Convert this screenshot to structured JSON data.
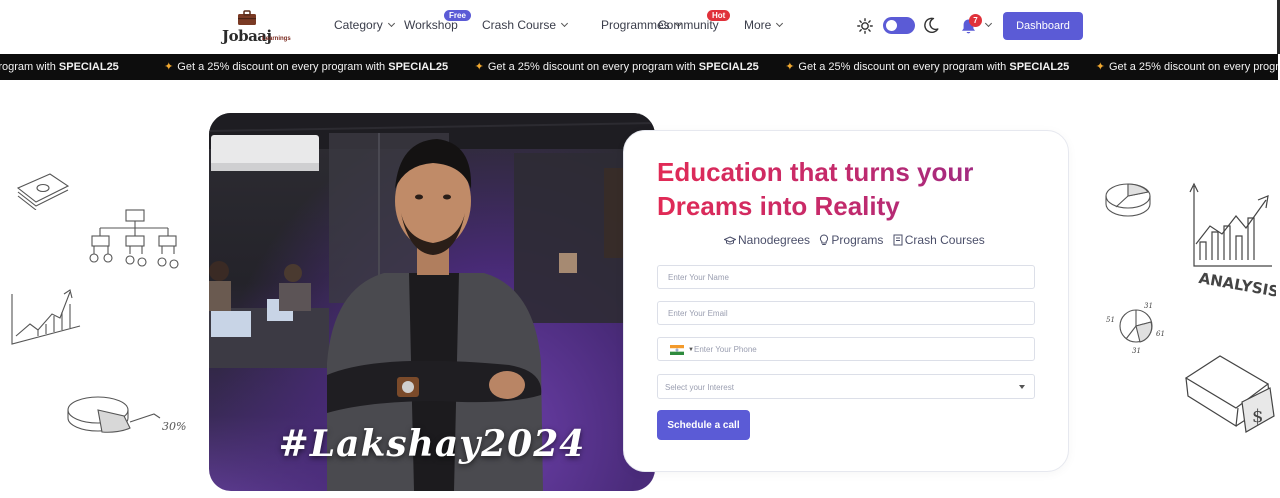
{
  "brand": {
    "logo_text": "Jobaaj",
    "logo_subtext": "Learnings"
  },
  "nav": {
    "items": [
      {
        "label": "Category",
        "has_dropdown": true
      },
      {
        "label": "Workshop",
        "has_dropdown": false,
        "badge": "Free"
      },
      {
        "label": "Crash Course",
        "has_dropdown": true
      },
      {
        "label": "Programmes",
        "has_dropdown": true
      },
      {
        "label": "Community",
        "has_dropdown": false,
        "badge": "Hot"
      },
      {
        "label": "More",
        "has_dropdown": true
      }
    ],
    "theme_toggle": {
      "mode": "light",
      "icons": [
        "sun-icon",
        "moon-icon"
      ]
    },
    "notifications": {
      "count": "7"
    },
    "dashboard_label": "Dashboard"
  },
  "ticker": {
    "prefix": "Get a 25% discount on every program with",
    "code": "SPECIAL25",
    "leading_fragment": "on every program with",
    "icon": "party-popper-icon"
  },
  "hero": {
    "hashtag": "#Lakshay2024"
  },
  "form": {
    "headline_line1": "Education that turns your",
    "headline_line2": "Dreams into Reality",
    "tags": [
      {
        "label": "Nanodegrees",
        "icon": "graduation-cap-icon"
      },
      {
        "label": "Programs",
        "icon": "lightbulb-icon"
      },
      {
        "label": "Crash Courses",
        "icon": "book-icon"
      }
    ],
    "name_placeholder": "Enter Your Name",
    "email_placeholder": "Enter Your Email",
    "phone_placeholder": "Enter Your Phone",
    "phone_country": "IN",
    "interest_placeholder": "Select your Interest",
    "cta_label": "Schedule a call"
  },
  "doodles": {
    "analysis_label": "ANALYSIS",
    "percent_label": "30%",
    "pie_labels": [
      "31",
      "51",
      "61",
      "31"
    ]
  },
  "colors": {
    "accent": "#5b5bd6",
    "headline_start": "#e12a55",
    "headline_end": "#8e2a8e",
    "ticker_bg": "#0d0d0d",
    "badge_hot": "#e0313a"
  }
}
